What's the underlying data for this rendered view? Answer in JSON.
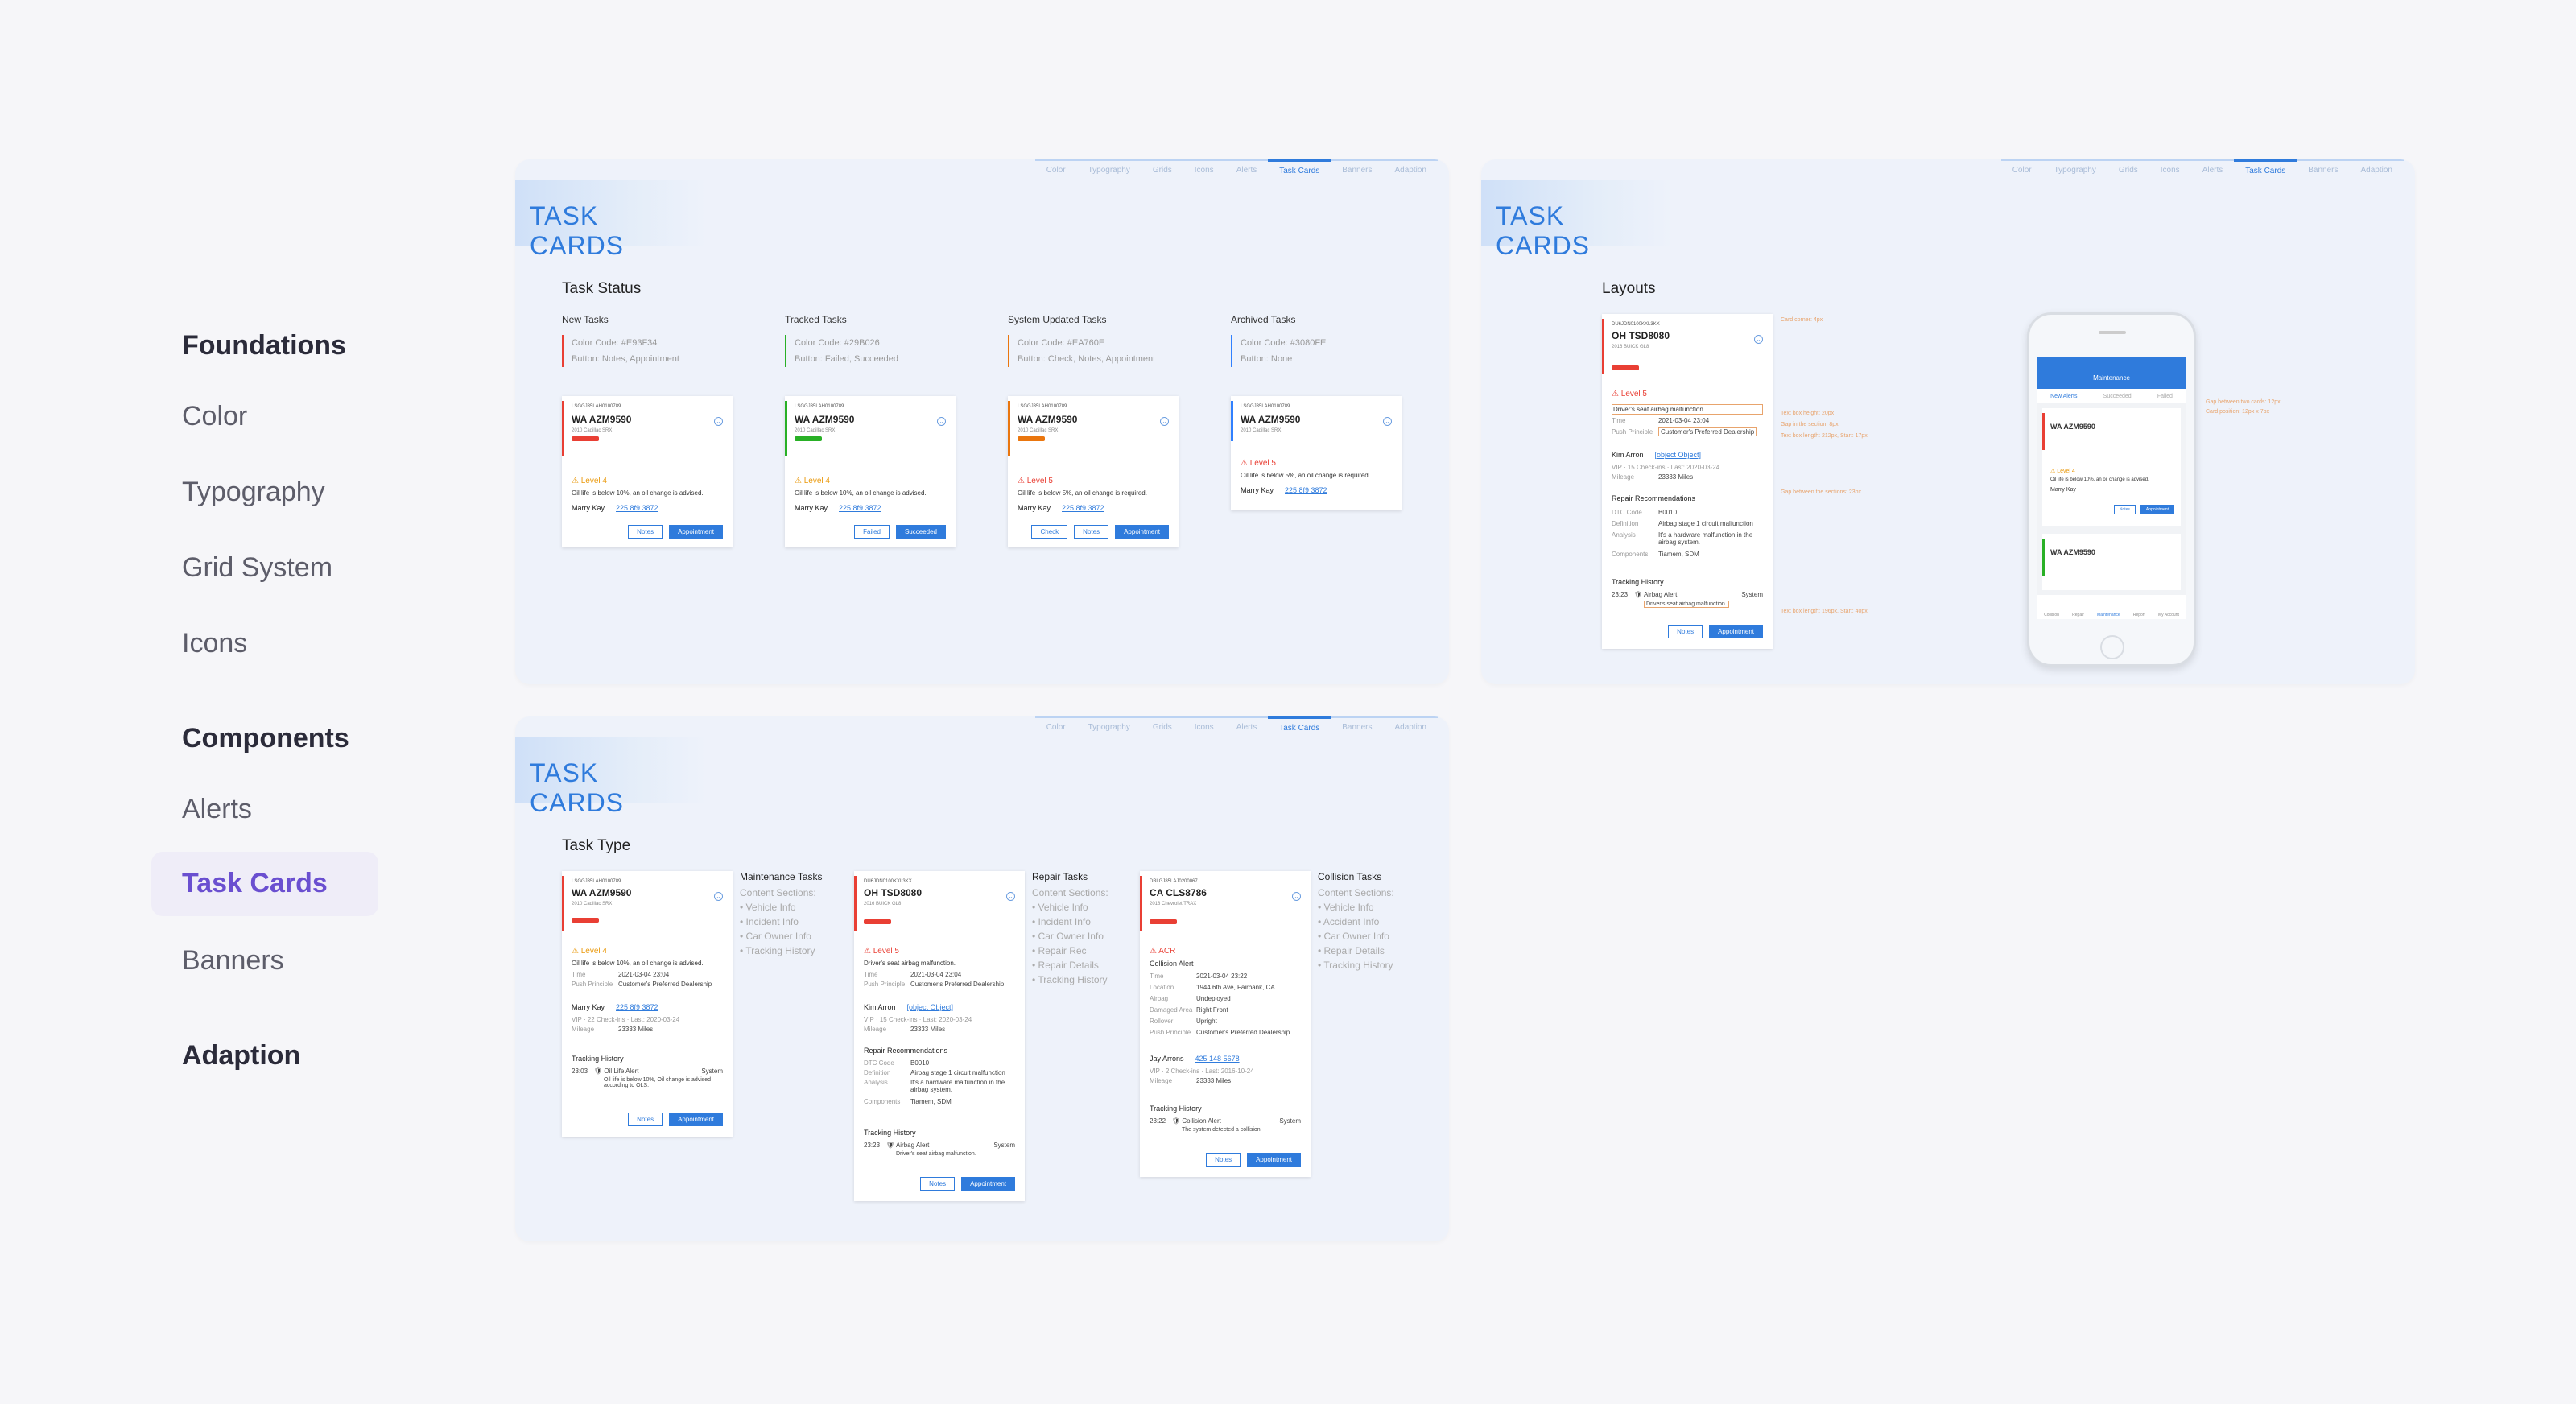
{
  "sidebar": {
    "sec1": "Foundations",
    "items1": [
      "Color",
      "Typography",
      "Grid System",
      "Icons"
    ],
    "sec2": "Components",
    "items2": [
      "Alerts",
      "Task Cards",
      "Banners"
    ],
    "sec3": "Adaption"
  },
  "panel_title": "TASK CARDS",
  "tabs": [
    "Color",
    "Typography",
    "Grids",
    "Icons",
    "Alerts",
    "Task Cards",
    "Banners",
    "Adaption"
  ],
  "status": {
    "heading": "Task Status",
    "cols": [
      {
        "title": "New Tasks",
        "color_code": "Color Code: #E93F34",
        "buttons": "Button: Notes, Appointment"
      },
      {
        "title": "Tracked Tasks",
        "color_code": "Color Code: #29B026",
        "buttons": "Button: Failed, Succeeded"
      },
      {
        "title": "System Updated Tasks",
        "color_code": "Color Code: #EA760E",
        "buttons": "Button: Check, Notes, Appointment"
      },
      {
        "title": "Archived Tasks",
        "color_code": "Color Code: #3080FE",
        "buttons": "Button: None"
      }
    ],
    "cards": [
      {
        "lp": "LSGGJ35LAH0100789",
        "plate": "WA AZM9590",
        "model": "2010 Cadillac SRX",
        "level": "Level 4",
        "msg": "Oil life is below 10%, an oil change is advised.",
        "owner": "Marry Kay",
        "phone": "225 8f9 3872",
        "b1": "Notes",
        "b2": "Appointment"
      },
      {
        "lp": "LSGGJ35LAH0100789",
        "plate": "WA AZM9590",
        "model": "2010 Cadillac SRX",
        "level": "Level 4",
        "msg": "Oil life is below 10%, an oil change is advised.",
        "owner": "Marry Kay",
        "phone": "225 8f9 3872",
        "b1": "Failed",
        "b2": "Succeeded"
      },
      {
        "lp": "LSGGJ35LAH0100789",
        "plate": "WA AZM9590",
        "model": "2010 Cadillac SRX",
        "level": "Level 5",
        "msg": "Oil life is below 5%, an oil change is required.",
        "owner": "Marry Kay",
        "phone": "225 8f9 3872",
        "b0": "Check",
        "b1": "Notes",
        "b2": "Appointment"
      },
      {
        "lp": "LSGGJ35LAH0100789",
        "plate": "WA AZM9590",
        "model": "2010 Cadillac SRX",
        "level": "Level 5",
        "msg": "Oil life is below 5%, an oil change is required.",
        "owner": "Marry Kay",
        "phone": "225 8f9 3872"
      }
    ]
  },
  "layouts": {
    "heading": "Layouts",
    "lp": "DU6JDN0100KXL3KX",
    "plate": "OH TSD8080",
    "model": "2016 BUICK GL8",
    "level": "Level 5",
    "msg": "Driver's seat airbag malfunction.",
    "time_l": "Time",
    "time": "2021-03-04 23:04",
    "pp_l": "Push Principle",
    "pp": "Customer's Preferred Dealership",
    "owner": "Kim Arron",
    "phone": {
      "title": "Maintenance",
      "tabs": [
        "New Alerts",
        "Succeeded",
        "Failed"
      ],
      "nav": [
        "Collision",
        "Repair",
        "Maintenance",
        "Report",
        "My Account"
      ]
    },
    "vip": "VIP · 15 Check-ins · Last: 2020-03-24",
    "mil_l": "Mileage",
    "mil": "23333 Miles",
    "rr": "Repair Recommendations",
    "dtc_l": "DTC Code",
    "dtc": "B0010",
    "def_l": "Definition",
    "def": "Airbag stage 1 circuit malfunction",
    "ana_l": "Analysis",
    "ana": "It's a hardware malfunction in the airbag system.",
    "comp_l": "Components",
    "comp": "Tiamem, SDM",
    "th": "Tracking History",
    "t1": "23:23",
    "t2": "Airbag Alert",
    "t3": "System",
    "t4": "Driver's seat airbag malfunction.",
    "b1": "Notes",
    "b2": "Appointment",
    "annotations": [
      "Card corner: 4px",
      "Text box height: 20px",
      "Gap in the section: 8px",
      "Text box length: 212px, Start: 17px",
      "Gap between the sections: 23px",
      "Text box length: 196px, Start: 40px",
      "Gap between two cards: 12px",
      "Card position: 12px x 7px"
    ]
  },
  "type": {
    "heading": "Task Type",
    "sections": [
      {
        "title": "Maintenance Tasks",
        "label": "Content Sections:",
        "items": [
          "• Vehicle Info",
          "• Incident Info",
          "• Car Owner Info",
          "• Tracking History"
        ]
      },
      {
        "title": "Repair Tasks",
        "label": "Content Sections:",
        "items": [
          "• Vehicle Info",
          "• Incident Info",
          "• Car Owner Info",
          "• Repair Rec",
          "• Repair Details",
          "• Tracking History"
        ]
      },
      {
        "title": "Collision Tasks",
        "label": "Content Sections:",
        "items": [
          "• Vehicle Info",
          "• Accident Info",
          "• Car Owner Info",
          "• Repair Details",
          "• Tracking History"
        ]
      }
    ],
    "c3": {
      "lp": "DBLGJ85LAJ0200067",
      "plate": "CA CLS8786",
      "model": "2018 Chevrolet TRAX",
      "level": "ACR",
      "alert": "Collision Alert",
      "rows": [
        [
          "Time",
          "2021-03-04 23:22"
        ],
        [
          "Location",
          "1944 6th Ave, Fairbank, CA"
        ],
        [
          "Airbag",
          "Undeployed"
        ],
        [
          "Damaged Area",
          "Right Front"
        ],
        [
          "Rollover",
          "Upright"
        ],
        [
          "Push Principle",
          "Customer's Preferred Dealership"
        ]
      ],
      "owner": "Jay Arrons",
      "phone": "425 148 5678",
      "vip": "VIP · 2 Check-ins · Last: 2016-10-24",
      "mil": "23333 Miles",
      "th": "Tracking History",
      "t1": "23:22",
      "t2": "Collision Alert",
      "t3": "System",
      "t4": "The system detected a collision."
    },
    "c1": {
      "time": "2021-03-04 23:04",
      "vip": "VIP · 22 Check-ins · Last: 2020-03-24",
      "mil": "23333 Miles",
      "t1": "23:03",
      "t2": "Oil Life Alert",
      "t4": "Oil life is below 10%, Oil change is advised according to OLS."
    }
  }
}
